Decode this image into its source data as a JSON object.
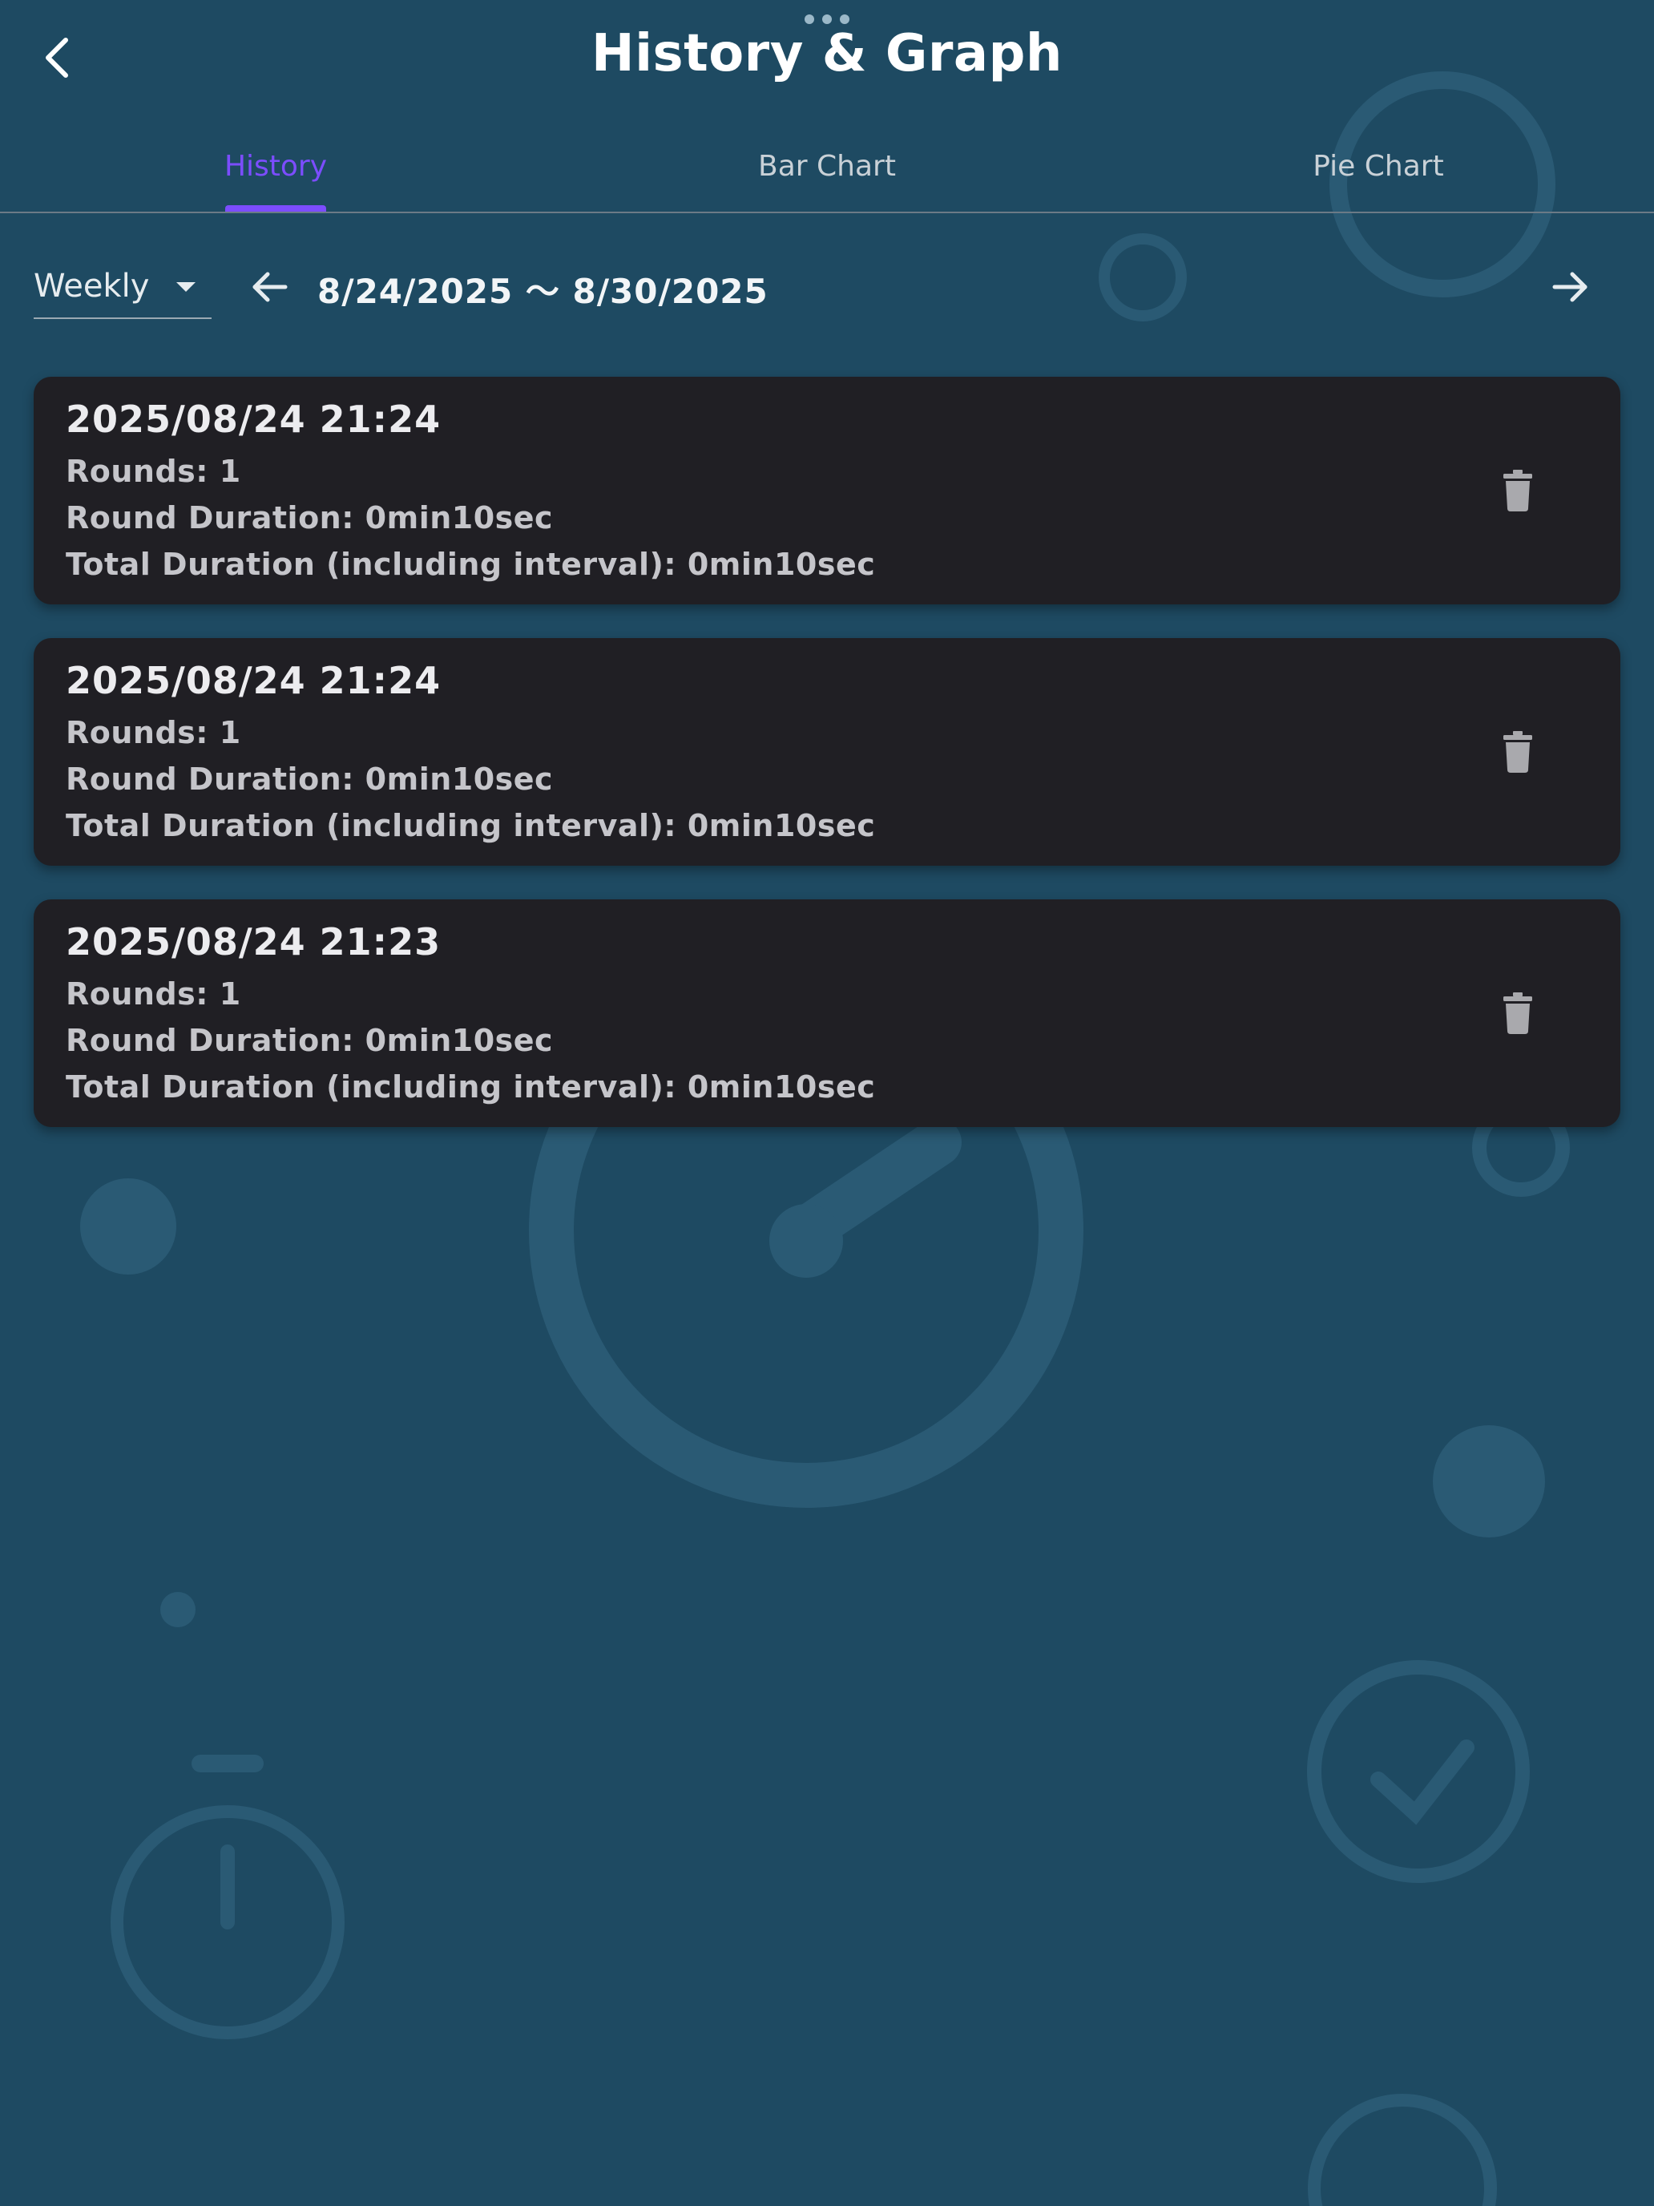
{
  "header": {
    "title": "History & Graph",
    "back_icon": "chevron-left-icon"
  },
  "tabs": [
    {
      "label": "History",
      "active": true
    },
    {
      "label": "Bar Chart",
      "active": false
    },
    {
      "label": "Pie Chart",
      "active": false
    }
  ],
  "filter": {
    "period": "Weekly",
    "range": "8/24/2025 〜 8/30/2025"
  },
  "entries": [
    {
      "date": "2025/08/24 21:24",
      "rounds": "Rounds: 1",
      "round_duration": "Round Duration: 0min10sec",
      "total_duration": "Total Duration (including interval): 0min10sec"
    },
    {
      "date": "2025/08/24 21:24",
      "rounds": "Rounds: 1",
      "round_duration": "Round Duration: 0min10sec",
      "total_duration": "Total Duration (including interval): 0min10sec"
    },
    {
      "date": "2025/08/24 21:23",
      "rounds": "Rounds: 1",
      "round_duration": "Round Duration: 0min10sec",
      "total_duration": "Total Duration (including interval): 0min10sec"
    }
  ],
  "colors": {
    "background": "#1e4a62",
    "accent": "#7c4dff",
    "card": "#201f24"
  }
}
